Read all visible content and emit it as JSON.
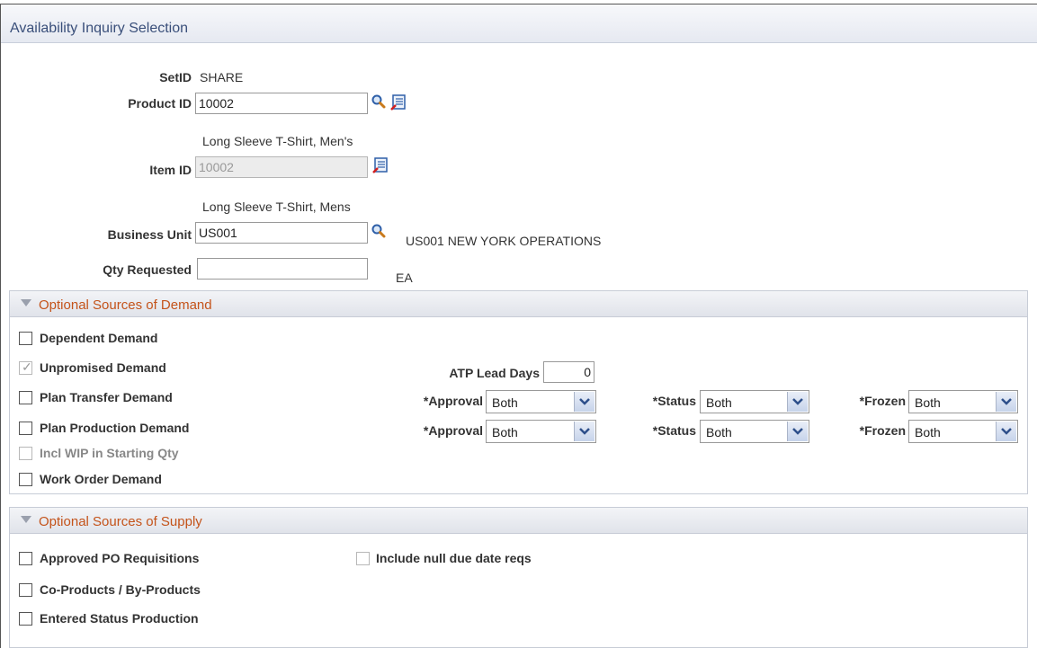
{
  "page": {
    "title": "Availability Inquiry Selection"
  },
  "header_fields": {
    "setid": {
      "label": "SetID",
      "value": "SHARE"
    },
    "product_id": {
      "label": "Product ID",
      "value": "10002",
      "description": "Long Sleeve T-Shirt, Men's"
    },
    "item_id": {
      "label": "Item ID",
      "value": "10002",
      "description": "Long Sleeve T-Shirt, Mens"
    },
    "business_unit": {
      "label": "Business Unit",
      "value": "US001",
      "description": "US001 NEW YORK OPERATIONS"
    },
    "qty_requested": {
      "label": "Qty Requested",
      "value": "",
      "uom": "EA"
    }
  },
  "demand_section": {
    "title": "Optional Sources of Demand",
    "dependent_demand": {
      "label": "Dependent Demand",
      "checked": false
    },
    "unpromised_demand": {
      "label": "Unpromised Demand",
      "checked": true
    },
    "plan_transfer_demand": {
      "label": "Plan Transfer Demand",
      "checked": false
    },
    "plan_production_demand": {
      "label": "Plan Production Demand",
      "checked": false
    },
    "incl_wip": {
      "label": "Incl WIP in Starting Qty",
      "checked": false
    },
    "work_order_demand": {
      "label": "Work Order Demand",
      "checked": false
    },
    "atp_lead_days": {
      "label": "ATP Lead Days",
      "value": "0"
    },
    "approval_label": "*Approval",
    "status_label": "*Status",
    "frozen_label": "*Frozen",
    "transfer_row": {
      "approval": "Both",
      "status": "Both",
      "frozen": "Both"
    },
    "production_row": {
      "approval": "Both",
      "status": "Both",
      "frozen": "Both"
    }
  },
  "supply_section": {
    "title": "Optional Sources of Supply",
    "approved_po_reqs": {
      "label": "Approved PO Requisitions",
      "checked": false
    },
    "include_null_due": {
      "label": "Include null due date reqs",
      "checked": false
    },
    "co_products": {
      "label": "Co-Products / By-Products",
      "checked": false
    },
    "entered_status_production": {
      "label": "Entered Status Production",
      "checked": false
    }
  },
  "colors": {
    "title": "#3a4f7a",
    "section_title": "#c4531a",
    "border": "#c7ccd6"
  },
  "icons": [
    "lookup-icon",
    "related-info-icon",
    "collapse-arrow-icon",
    "dropdown-arrow-icon"
  ]
}
